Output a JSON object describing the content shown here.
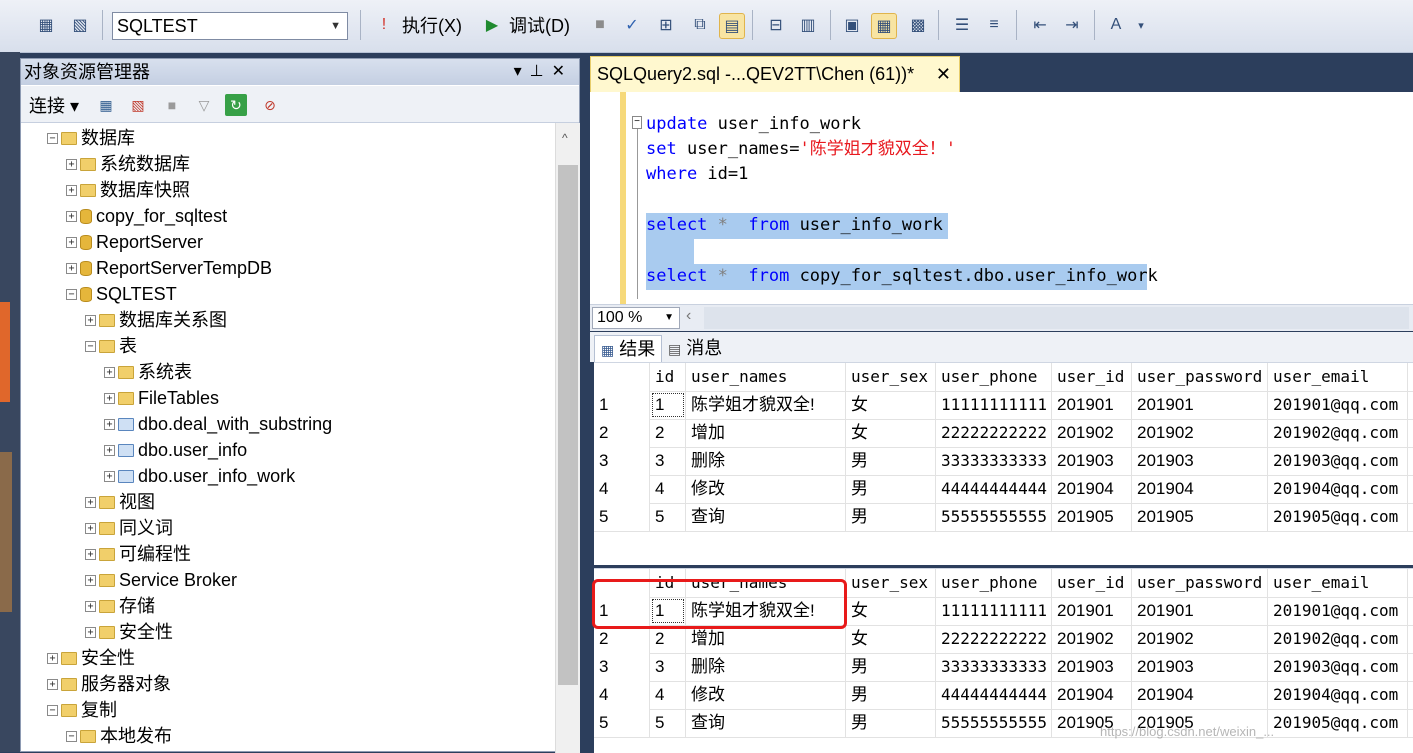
{
  "toolbar": {
    "database": "SQLTEST",
    "execute_label": "执行(X)",
    "debug_label": "调试(D)"
  },
  "object_explorer": {
    "title": "对象资源管理器",
    "connect_label": "连接",
    "tree": [
      {
        "label": "数据库",
        "level": 1,
        "expander": "−",
        "icon": "folder-icon"
      },
      {
        "label": "系统数据库",
        "level": 2,
        "expander": "+",
        "icon": "folder-icon"
      },
      {
        "label": "数据库快照",
        "level": 2,
        "expander": "+",
        "icon": "folder-icon"
      },
      {
        "label": "copy_for_sqltest",
        "level": 2,
        "expander": "+",
        "icon": "database-icon"
      },
      {
        "label": "ReportServer",
        "level": 2,
        "expander": "+",
        "icon": "database-icon"
      },
      {
        "label": "ReportServerTempDB",
        "level": 2,
        "expander": "+",
        "icon": "database-icon"
      },
      {
        "label": "SQLTEST",
        "level": 2,
        "expander": "−",
        "icon": "database-icon"
      },
      {
        "label": "数据库关系图",
        "level": 3,
        "expander": "+",
        "icon": "folder-icon"
      },
      {
        "label": "表",
        "level": 3,
        "expander": "−",
        "icon": "folder-icon"
      },
      {
        "label": "系统表",
        "level": 4,
        "expander": "+",
        "icon": "folder-icon"
      },
      {
        "label": "FileTables",
        "level": 4,
        "expander": "+",
        "icon": "folder-icon"
      },
      {
        "label": "dbo.deal_with_substring",
        "level": 4,
        "expander": "+",
        "icon": "table-icon"
      },
      {
        "label": "dbo.user_info",
        "level": 4,
        "expander": "+",
        "icon": "table-icon"
      },
      {
        "label": "dbo.user_info_work",
        "level": 4,
        "expander": "+",
        "icon": "table-icon"
      },
      {
        "label": "视图",
        "level": 3,
        "expander": "+",
        "icon": "folder-icon"
      },
      {
        "label": "同义词",
        "level": 3,
        "expander": "+",
        "icon": "folder-icon"
      },
      {
        "label": "可编程性",
        "level": 3,
        "expander": "+",
        "icon": "folder-icon"
      },
      {
        "label": "Service Broker",
        "level": 3,
        "expander": "+",
        "icon": "folder-icon"
      },
      {
        "label": "存储",
        "level": 3,
        "expander": "+",
        "icon": "folder-icon"
      },
      {
        "label": "安全性",
        "level": 3,
        "expander": "+",
        "icon": "folder-icon"
      },
      {
        "label": "安全性",
        "level": 1,
        "expander": "+",
        "icon": "folder-icon"
      },
      {
        "label": "服务器对象",
        "level": 1,
        "expander": "+",
        "icon": "folder-icon"
      },
      {
        "label": "复制",
        "level": 1,
        "expander": "−",
        "icon": "folder-icon"
      },
      {
        "label": "本地发布",
        "level": 2,
        "expander": "−",
        "icon": "folder-icon"
      }
    ]
  },
  "editor": {
    "tab_title": "SQLQuery2.sql -...QEV2TT\\Chen (61))*",
    "zoom": "100 %",
    "line1_kw": "update",
    "line1_rest": " user_info_work",
    "line2_kw": "set",
    "line2_rest": " user_names=",
    "line2_str": "'陈学姐才貌双全！'",
    "line3_kw": "where",
    "line3_rest": " id=1",
    "line5_kw": "select",
    "line5_star": " *  ",
    "line5_from": "from",
    "line5_rest": " user_info_work",
    "line7_kw": "select",
    "line7_star": " *  ",
    "line7_from": "from",
    "line7_rest": " copy_for_sqltest.dbo.user_info_work"
  },
  "results": {
    "tab_results": "结果",
    "tab_messages": "消息",
    "columns": [
      "id",
      "user_names",
      "user_sex",
      "user_phone",
      "user_id",
      "user_password",
      "user_email"
    ],
    "grid1": [
      [
        "1",
        "1",
        "陈学姐才貌双全!",
        "女",
        "11111111111",
        "201901",
        "201901",
        "201901@qq.com"
      ],
      [
        "2",
        "2",
        "增加",
        "女",
        "22222222222",
        "201902",
        "201902",
        "201902@qq.com"
      ],
      [
        "3",
        "3",
        "删除",
        "男",
        "33333333333",
        "201903",
        "201903",
        "201903@qq.com"
      ],
      [
        "4",
        "4",
        "修改",
        "男",
        "44444444444",
        "201904",
        "201904",
        "201904@qq.com"
      ],
      [
        "5",
        "5",
        "查询",
        "男",
        "55555555555",
        "201905",
        "201905",
        "201905@qq.com"
      ]
    ],
    "grid2": [
      [
        "1",
        "1",
        "陈学姐才貌双全!",
        "女",
        "11111111111",
        "201901",
        "201901",
        "201901@qq.com"
      ],
      [
        "2",
        "2",
        "增加",
        "女",
        "22222222222",
        "201902",
        "201902",
        "201902@qq.com"
      ],
      [
        "3",
        "3",
        "删除",
        "男",
        "33333333333",
        "201903",
        "201903",
        "201903@qq.com"
      ],
      [
        "4",
        "4",
        "修改",
        "男",
        "44444444444",
        "201904",
        "201904",
        "201904@qq.com"
      ],
      [
        "5",
        "5",
        "查询",
        "男",
        "55555555555",
        "201905",
        "201905",
        "201905@qq.com"
      ]
    ]
  },
  "watermark": "https://blog.csdn.net/weixin_..."
}
